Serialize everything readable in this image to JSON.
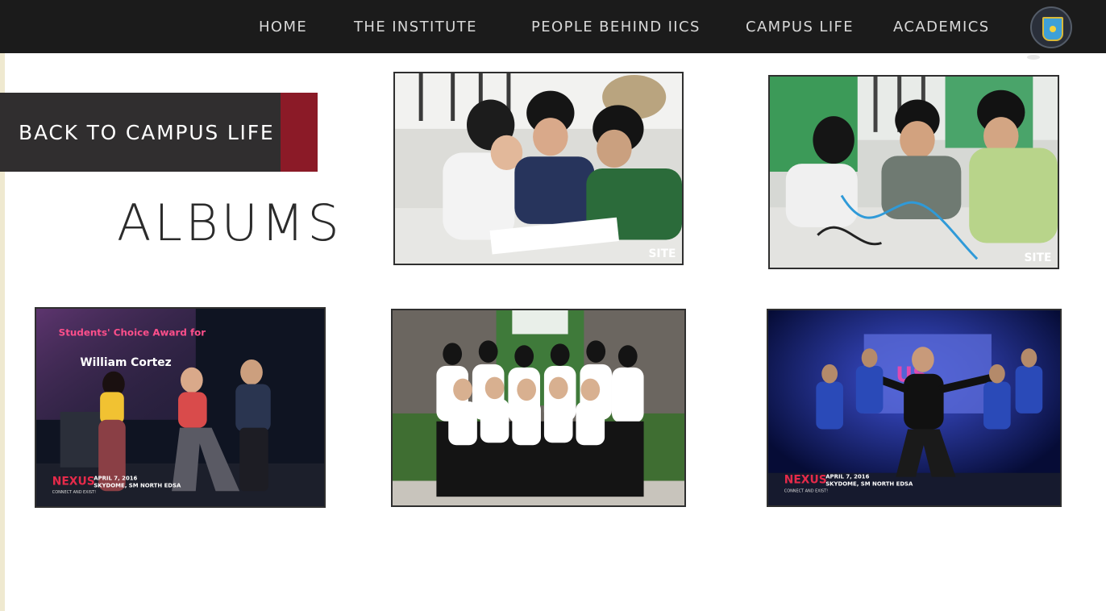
{
  "nav": {
    "items": [
      {
        "label": "HOME"
      },
      {
        "label": "THE INSTITUTE"
      },
      {
        "label": "PEOPLE BEHIND IICS"
      },
      {
        "label": "CAMPUS LIFE"
      },
      {
        "label": "ACADEMICS"
      }
    ]
  },
  "sidebar": {
    "back_label": "BACK TO CAMPUS LIFE",
    "albums_title": "ALBUMS"
  },
  "albums": [
    {
      "watermark": "SITE"
    },
    {
      "watermark": "SITE"
    },
    {
      "overlay_title": "Students' Choice Award for",
      "overlay_name": "William Cortez",
      "event_logo": "NEXUS",
      "event_tagline": "CONNECT AND EXIST!",
      "event_date": "APRIL 7, 2016",
      "event_venue": "SKYDOME, SM NORTH EDSA"
    },
    {},
    {
      "event_logo": "NEXUS",
      "event_tagline": "CONNECT AND EXIST!",
      "event_date": "APRIL 7, 2016",
      "event_venue": "SKYDOME, SM NORTH EDSA"
    }
  ],
  "colors": {
    "navbar": "#1b1b1b",
    "accent": "#8b1a27",
    "button": "#302e2f"
  }
}
